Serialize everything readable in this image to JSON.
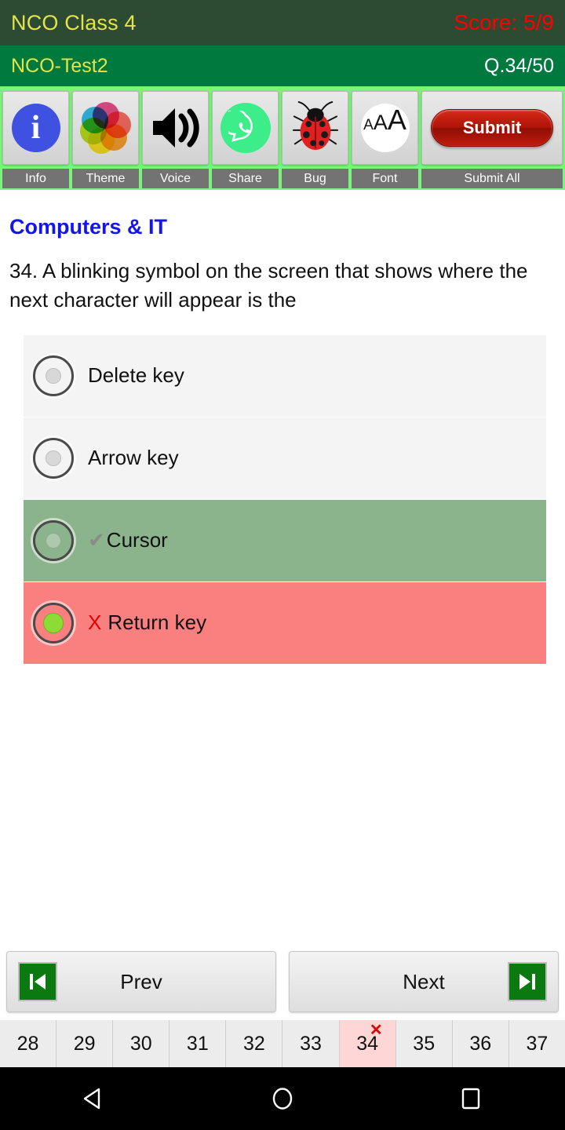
{
  "titlebar": {
    "app_title": "NCO Class 4",
    "score": "Score: 5/9"
  },
  "subbar": {
    "test_name": "NCO-Test2",
    "question_counter": "Q.34/50"
  },
  "toolbar": {
    "items": [
      {
        "label": "Info",
        "icon": "info-icon"
      },
      {
        "label": "Theme",
        "icon": "color-palette-icon"
      },
      {
        "label": "Voice",
        "icon": "speaker-icon"
      },
      {
        "label": "Share",
        "icon": "whatsapp-share-icon"
      },
      {
        "label": "Bug",
        "icon": "ladybug-icon"
      },
      {
        "label": "Font",
        "icon": "font-size-icon"
      },
      {
        "label": "Submit All",
        "icon": "submit-button"
      }
    ],
    "submit_label": "Submit"
  },
  "content": {
    "subject": "Computers & IT",
    "question": "34. A blinking symbol on the screen that shows where the next character will appear is the",
    "options": [
      {
        "text": "Delete key",
        "state": "plain",
        "marker": "",
        "selected": false
      },
      {
        "text": "Arrow key",
        "state": "plain",
        "marker": "",
        "selected": false
      },
      {
        "text": "Cursor",
        "state": "correct",
        "marker": "✔",
        "selected": false
      },
      {
        "text": "Return key",
        "state": "wrong",
        "marker": "X",
        "selected": true
      }
    ]
  },
  "navigation": {
    "prev_label": "Prev",
    "next_label": "Next"
  },
  "qstrip": {
    "cells": [
      {
        "num": "28",
        "marked": false,
        "badge": ""
      },
      {
        "num": "29",
        "marked": false,
        "badge": ""
      },
      {
        "num": "30",
        "marked": false,
        "badge": ""
      },
      {
        "num": "31",
        "marked": false,
        "badge": ""
      },
      {
        "num": "32",
        "marked": false,
        "badge": ""
      },
      {
        "num": "33",
        "marked": false,
        "badge": ""
      },
      {
        "num": "34",
        "marked": true,
        "badge": "✕"
      },
      {
        "num": "35",
        "marked": false,
        "badge": ""
      },
      {
        "num": "36",
        "marked": false,
        "badge": ""
      },
      {
        "num": "37",
        "marked": false,
        "badge": ""
      }
    ]
  },
  "system_nav": {
    "back": "back-triangle-icon",
    "home": "home-circle-icon",
    "recents": "recents-square-icon"
  },
  "colors": {
    "titlebar_bg": "#2d4a33",
    "title_text": "#e3e34a",
    "score_text": "#ff0000",
    "subbar_bg": "#00793f",
    "toolbar_bg": "#7bf47b",
    "subject_text": "#1414f0",
    "correct_bg": "#8cb48c",
    "wrong_bg": "#fa8080",
    "submit_red": "#b01408",
    "marked_cell_bg": "#ffd6d6"
  }
}
